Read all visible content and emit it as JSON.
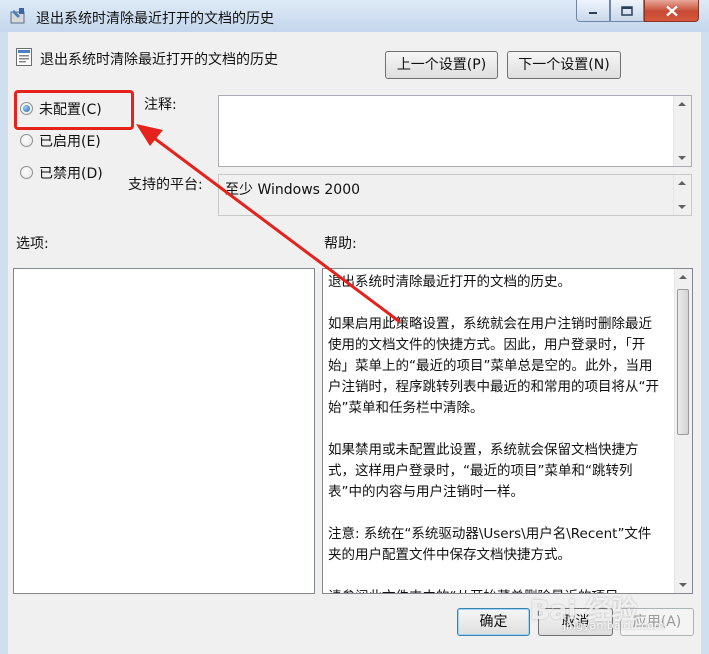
{
  "window": {
    "title": "退出系统时清除最近打开的文档的历史",
    "icons": {
      "app": "policy-settings-icon",
      "minimize": "minimize-icon",
      "maximize": "maximize-icon",
      "close": "close-icon"
    }
  },
  "header": {
    "policy_name": "退出系统时清除最近打开的文档的历史",
    "policy_icon": "policy-settings-icon",
    "prev_setting": "上一个设置(P)",
    "next_setting": "下一个设置(N)"
  },
  "state_options": [
    {
      "label": "未配置(C)",
      "selected": true
    },
    {
      "label": "已启用(E)",
      "selected": false
    },
    {
      "label": "已禁用(D)",
      "selected": false
    }
  ],
  "comment": {
    "label": "注释:",
    "value": ""
  },
  "supported": {
    "label": "支持的平台:",
    "value": "至少 Windows 2000"
  },
  "options_label": "选项:",
  "help_label": "帮助:",
  "help_text": "退出系统时清除最近打开的文档的历史。\n\n如果启用此策略设置，系统就会在用户注销时删除最近使用的文档文件的快捷方式。因此，用户登录时，「开始」菜单上的“最近的项目”菜单总是空的。此外，当用户注销时，程序跳转列表中最近的和常用的项目将从“开始”菜单和任务栏中清除。\n\n如果禁用或未配置此设置，系统就会保留文档快捷方式，这样用户登录时，“最近的项目”菜单和“跳转列表”中的内容与用户注销时一样。\n\n注意: 系统在“系统驱动器\\Users\\用户名\\Recent”文件夹的用户配置文件中保存文档快捷方式。\n\n请参阅此文件夹中的“从开始菜单删除最近的项目",
  "buttons": {
    "ok": "确定",
    "cancel": "取消",
    "apply": "应用(A)"
  },
  "watermark": {
    "main": "Bai 经验",
    "sub": "jingyan.baidu.com"
  },
  "colors": {
    "annotation": "#e5221b",
    "close_button": "#c74a33",
    "radio_selected": "#1f5fa8"
  }
}
